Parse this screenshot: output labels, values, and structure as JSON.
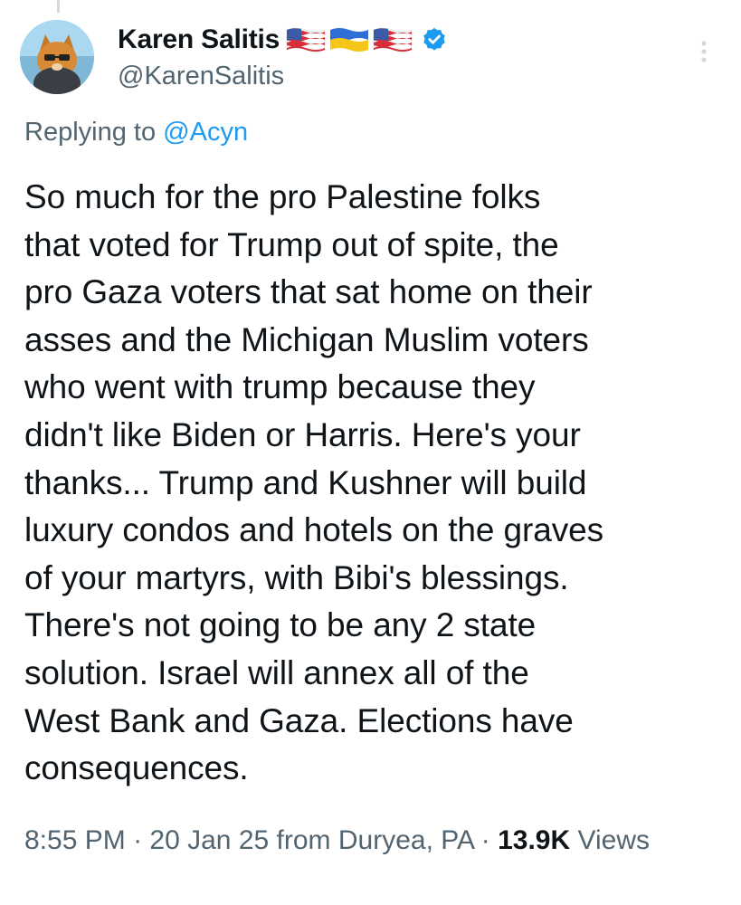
{
  "tweet": {
    "author": {
      "name": "Karen Salitis",
      "handle": "@KarenSalitis",
      "flags": [
        "us-flag-icon",
        "ukraine-flag-icon",
        "us-flag-icon"
      ],
      "verified": true
    },
    "reply_context": {
      "prefix": "Replying to",
      "mention": "@Acyn"
    },
    "text": "So much for the pro Palestine folks\nthat voted for Trump out of spite, the\npro Gaza voters that sat home on their\nasses and the Michigan Muslim voters\nwho went with trump because they\ndidn't like Biden or Harris. Here's your\nthanks... Trump and Kushner will build\nluxury condos and hotels on the graves\nof your martyrs, with Bibi's blessings.\nThere's not going to be any 2 state\nsolution. Israel will annex all of the\nWest Bank and Gaza. Elections have\nconsequences.",
    "time": "8:55 PM",
    "separator": "·",
    "date": "20 Jan 25",
    "source": "from Duryea, PA",
    "views_count": "13.9K",
    "views_label": "Views"
  },
  "colors": {
    "text": "#0f1419",
    "secondary": "#536471",
    "link": "#1d9bf0",
    "verified": "#1d9bf0"
  }
}
